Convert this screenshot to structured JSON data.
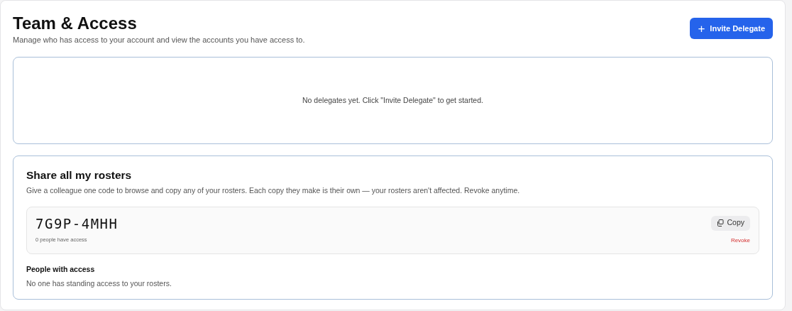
{
  "header": {
    "title": "Team & Access",
    "subtitle": "Manage who has access to your account and view the accounts you have access to.",
    "invite_button": {
      "icon": "+",
      "label": "Invite Delegate"
    }
  },
  "delegates": {
    "empty_message": "No delegates yet. Click \"Invite Delegate\" to get started."
  },
  "share": {
    "title": "Share all my rosters",
    "description": "Give a colleague one code to browse and copy any of your rosters. Each copy they make is their own — your rosters aren't affected. Revoke anytime.",
    "code": "7G9P-4MHH",
    "access_count": "0 people have access",
    "copy_button": "Copy",
    "revoke_link": "Revoke",
    "people_heading": "People with access",
    "people_empty": "No one has standing access to your rosters."
  }
}
